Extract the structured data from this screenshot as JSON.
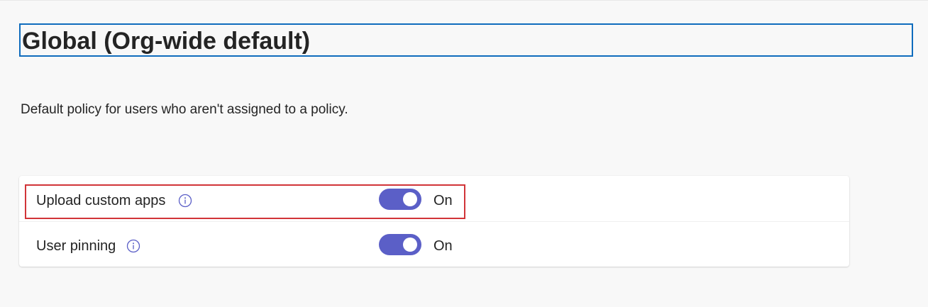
{
  "policy": {
    "title": "Global (Org-wide default)",
    "description": "Default policy for users who aren't assigned to a policy."
  },
  "settings": [
    {
      "label": "Upload custom apps",
      "enabled": true,
      "state_label": "On",
      "highlighted": true,
      "info_icon": "info-icon"
    },
    {
      "label": "User pinning",
      "enabled": true,
      "state_label": "On",
      "highlighted": false,
      "info_icon": "info-icon"
    }
  ],
  "colors": {
    "toggle_on": "#5b5fc7",
    "focus_border": "#0f6cbd",
    "highlight_border": "#d13438",
    "info_icon": "#5b5fc7"
  }
}
